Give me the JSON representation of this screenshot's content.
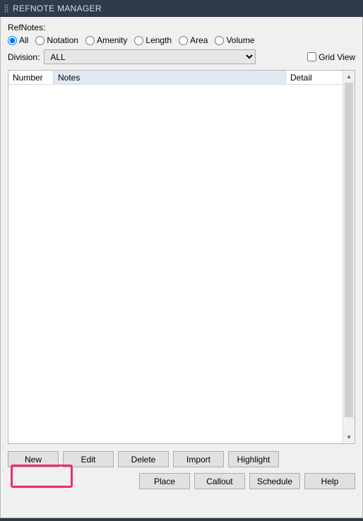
{
  "window": {
    "title": "REFNOTE MANAGER"
  },
  "refnotes": {
    "label": "RefNotes:",
    "filters": {
      "all": "All",
      "notation": "Notation",
      "amenity": "Amenity",
      "length": "Length",
      "area": "Area",
      "volume": "Volume"
    },
    "selected_filter": "all"
  },
  "division": {
    "label": "Division:",
    "value": "ALL",
    "options": [
      "ALL"
    ]
  },
  "gridview": {
    "label": "Grid View",
    "checked": false
  },
  "table": {
    "columns": {
      "number": "Number",
      "notes": "Notes",
      "detail": "Detail"
    },
    "rows": []
  },
  "buttons_row1": {
    "new": "New",
    "edit": "Edit",
    "delete": "Delete",
    "import": "Import",
    "highlight": "Highlight"
  },
  "buttons_row2": {
    "place": "Place",
    "callout": "Callout",
    "schedule": "Schedule",
    "help": "Help"
  }
}
